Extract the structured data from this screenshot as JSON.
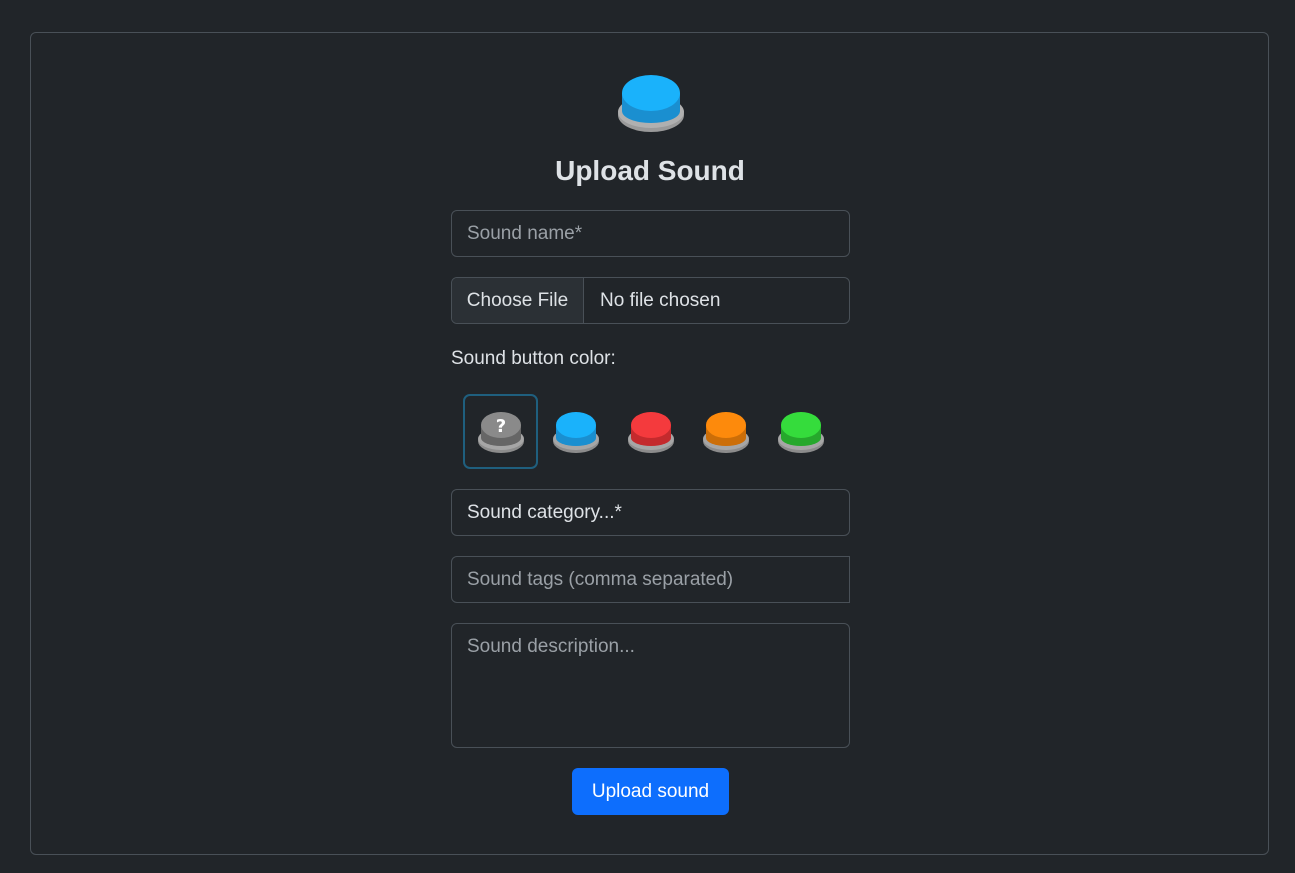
{
  "page": {
    "title": "Upload Sound"
  },
  "form": {
    "name_placeholder": "Sound name*",
    "file_button_label": "Choose File",
    "file_status": "No file chosen",
    "color_label": "Sound button color:",
    "category_label": "Sound category...*",
    "tags_placeholder": "Sound tags (comma separated)",
    "description_placeholder": "Sound description...",
    "submit_label": "Upload sound"
  },
  "colors": {
    "background": "#212529",
    "accent": "#0d6efd",
    "logo_button": "#1ab2fb",
    "swatches": [
      {
        "name": "gray",
        "hex": "#8a8a8a",
        "selected": true,
        "symbol": "?"
      },
      {
        "name": "blue",
        "hex": "#1ab2fb",
        "selected": false
      },
      {
        "name": "red",
        "hex": "#f43a3d",
        "selected": false
      },
      {
        "name": "orange",
        "hex": "#fd8a0c",
        "selected": false
      },
      {
        "name": "green",
        "hex": "#35dc3c",
        "selected": false
      }
    ]
  }
}
